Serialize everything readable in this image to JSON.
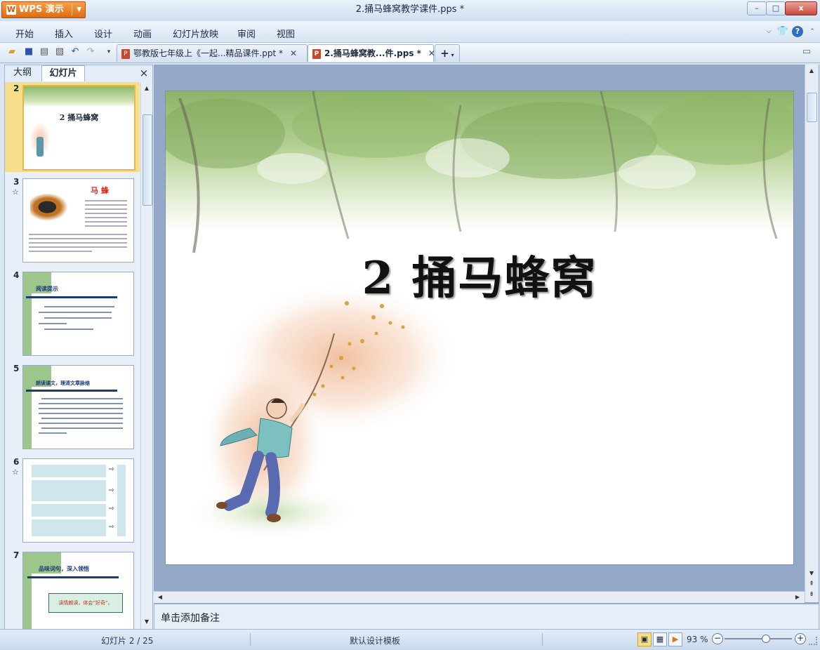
{
  "window": {
    "app_button_label": "WPS 演示",
    "title": "2.捅马蜂窝教学课件.pps *",
    "minimize_glyph": "–",
    "maximize_glyph": "□",
    "close_glyph": "x"
  },
  "menu": {
    "items": [
      "开始",
      "插入",
      "设计",
      "动画",
      "幻灯片放映",
      "审阅",
      "视图"
    ],
    "right_icons": [
      "chevron-down-icon",
      "skin-icon",
      "help-icon",
      "ribbon-collapse-icon"
    ]
  },
  "toolbar": {
    "quick_icons": [
      "open-icon",
      "save-icon",
      "print-icon",
      "print-preview-icon",
      "undo-icon",
      "redo-icon",
      "customize-icon"
    ],
    "tabs": [
      {
        "label": "鄂教版七年级上《一起...精品课件.ppt *",
        "active": false
      },
      {
        "label": "2.捅马蜂窝教...件.pps *",
        "active": true
      }
    ],
    "new_tab_glyph": "+"
  },
  "left_panel": {
    "tabs": [
      "大纲",
      "幻灯片"
    ],
    "active_tab": "幻灯片",
    "close_glyph": "×",
    "thumbnails": [
      {
        "number": "2",
        "selected": true,
        "has_animation": false,
        "heading": "2  捅马蜂窝"
      },
      {
        "number": "3",
        "selected": false,
        "has_animation": true,
        "heading": "马 蜂"
      },
      {
        "number": "4",
        "selected": false,
        "has_animation": false,
        "heading": "阅读提示"
      },
      {
        "number": "5",
        "selected": false,
        "has_animation": false,
        "heading": "朗读课文，理清文章脉络"
      },
      {
        "number": "6",
        "selected": false,
        "has_animation": true,
        "heading": ""
      },
      {
        "number": "7",
        "selected": false,
        "has_animation": false,
        "heading": "品味词句，深入领悟",
        "sub": "读情朗读，体会“好奇”。"
      }
    ]
  },
  "slide": {
    "title": "2   捅马蜂窝"
  },
  "notes": {
    "placeholder": "单击添加备注"
  },
  "status": {
    "slide_counter": "幻灯片 2 / 25",
    "template": "默认设计模板",
    "zoom": "93 %",
    "zoom_level_percent": 93,
    "view_icons": [
      "normal-view-icon",
      "slide-sorter-icon",
      "slideshow-icon"
    ]
  },
  "colors": {
    "accent_orange": "#e06a10",
    "thumb_selected": "#f6dd8a",
    "slide_bg_area": "#93a9c7",
    "thumb_heading_red": "#d42a1a",
    "thumb_heading_blue": "#1a3a78",
    "thumb_side_green": "#9cc68c"
  }
}
